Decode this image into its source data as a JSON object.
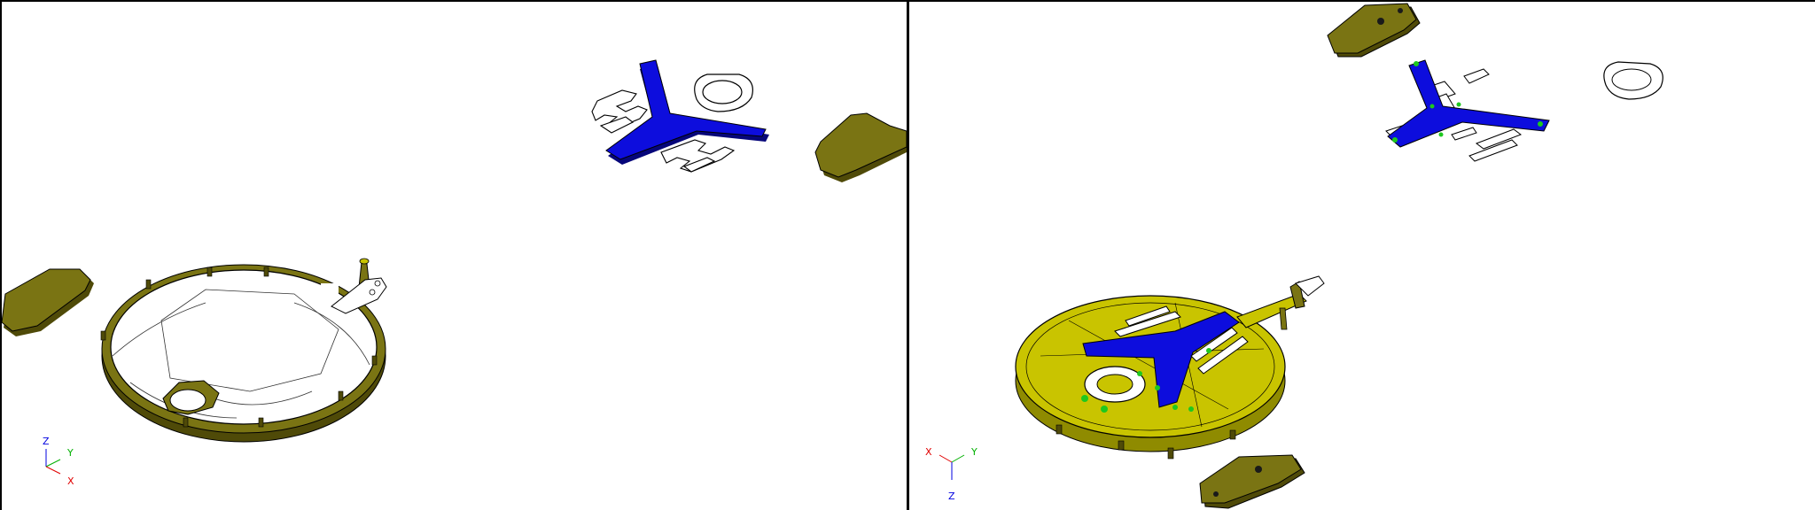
{
  "colors": {
    "part_olive": "#7a7413",
    "part_olive_dark": "#4f4a08",
    "assembly_yellow": "#c9c400",
    "assembly_yellow_dark": "#8f8b00",
    "bracket_blue": "#0d0ddd",
    "bracket_blue_dark": "#06067a",
    "outline": "#000000",
    "highlight_green": "#1ec81e",
    "axis_x": "#e00000",
    "axis_y": "#00b000",
    "axis_z": "#0000e0"
  },
  "icons": {
    "left_triad": "xyz-orientation-triad-icon",
    "right_triad": "xyz-orientation-triad-icon"
  },
  "left_view": {
    "triad": {
      "z": "Z",
      "y": "Y",
      "x": "X"
    }
  },
  "right_view": {
    "triad": {
      "x": "X",
      "y": "Y",
      "z": "Z"
    }
  }
}
